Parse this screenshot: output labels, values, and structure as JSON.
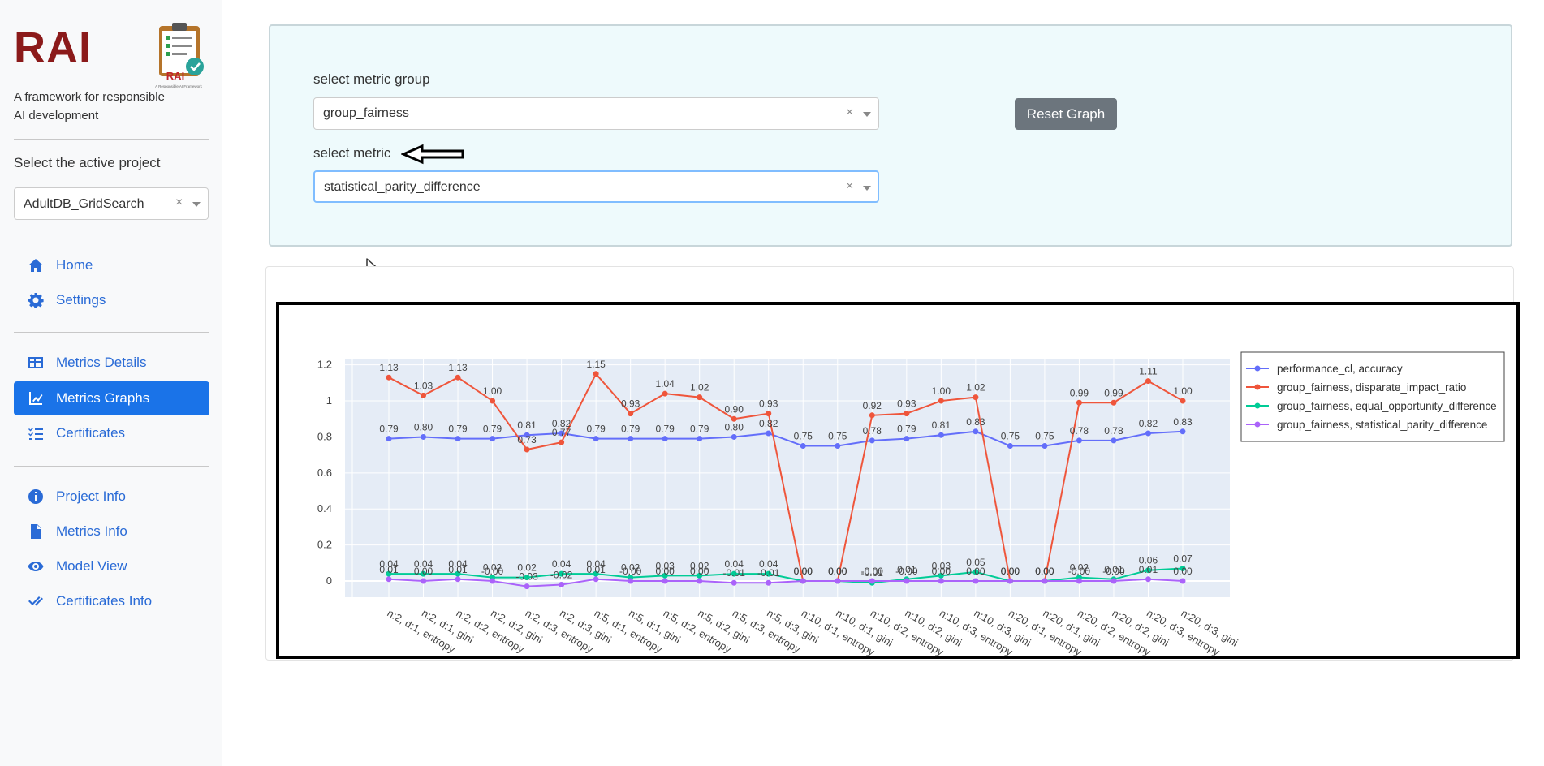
{
  "sidebar": {
    "brand": "RAI",
    "logo_text": "RAI",
    "logo_subtext": "A Responsible AI Framework",
    "tagline": "A framework for responsible AI development",
    "project_label": "Select the active project",
    "project_value": "AdultDB_GridSearch",
    "clear_glyph": "×",
    "nav_primary": [
      {
        "label": "Home",
        "icon": "home-icon"
      },
      {
        "label": "Settings",
        "icon": "gear-icon"
      }
    ],
    "nav_metrics": [
      {
        "label": "Metrics Details",
        "icon": "table-icon"
      },
      {
        "label": "Metrics Graphs",
        "icon": "chart-icon",
        "active": true
      },
      {
        "label": "Certificates",
        "icon": "checklist-icon"
      }
    ],
    "nav_info": [
      {
        "label": "Project Info",
        "icon": "info-icon"
      },
      {
        "label": "Metrics Info",
        "icon": "file-icon"
      },
      {
        "label": "Model View",
        "icon": "eye-icon"
      },
      {
        "label": "Certificates Info",
        "icon": "double-check-icon"
      }
    ]
  },
  "controls": {
    "group_label": "select metric group",
    "group_value": "group_fairness",
    "metric_label": "select metric",
    "metric_value": "statistical_parity_difference",
    "clear_glyph": "×",
    "reset_label": "Reset Graph"
  },
  "colors": {
    "accent": "#1a73e8",
    "brand": "#8b1a1a",
    "panel_bg": "#eefafc",
    "plot_bg": "#e5ecf6"
  },
  "chart_data": {
    "type": "line",
    "x": [
      "n:2, d:1, entropy",
      "n:2, d:1, gini",
      "n:2, d:2, entropy",
      "n:2, d:2, gini",
      "n:2, d:3, entropy",
      "n:2, d:3, gini",
      "n:5, d:1, entropy",
      "n:5, d:1, gini",
      "n:5, d:2, entropy",
      "n:5, d:2, gini",
      "n:5, d:3, entropy",
      "n:5, d:3, gini",
      "n:10, d:1, entropy",
      "n:10, d:1, gini",
      "n:10, d:2, entropy",
      "n:10, d:2, gini",
      "n:10, d:3, entropy",
      "n:10, d:3, gini",
      "n:20, d:1, entropy",
      "n:20, d:1, gini",
      "n:20, d:2, entropy",
      "n:20, d:2, gini",
      "n:20, d:3, entropy",
      "n:20, d:3, gini"
    ],
    "yticks": [
      "0",
      "0.2",
      "0.4",
      "0.6",
      "0.8",
      "1",
      "1.2"
    ],
    "ylim": [
      -0.09,
      1.23
    ],
    "legend_position": "top-right",
    "grid": true,
    "series": [
      {
        "name": "performance_cl, accuracy",
        "color": "#636efa",
        "values": [
          0.79,
          0.8,
          0.79,
          0.79,
          0.81,
          0.82,
          0.79,
          0.79,
          0.79,
          0.79,
          0.8,
          0.82,
          0.75,
          0.75,
          0.78,
          0.79,
          0.81,
          0.83,
          0.75,
          0.75,
          0.78,
          0.78,
          0.82,
          0.83
        ],
        "labels": [
          "0.79",
          "0.80",
          "0.79",
          "0.79",
          "0.81",
          "0.82",
          "0.79",
          "0.79",
          "0.79",
          "0.79",
          "0.80",
          "0.82",
          "0.75",
          "0.75",
          "0.78",
          "0.79",
          "0.81",
          "0.83",
          "0.75",
          "0.75",
          "0.78",
          "0.78",
          "0.82",
          "0.83"
        ]
      },
      {
        "name": "group_fairness, disparate_impact_ratio",
        "color": "#ef553b",
        "values": [
          1.13,
          1.03,
          1.13,
          1.0,
          0.73,
          0.77,
          1.15,
          0.93,
          1.04,
          1.02,
          0.9,
          0.93,
          0.0,
          0.0,
          0.92,
          0.93,
          1.0,
          1.02,
          0.0,
          0.0,
          0.99,
          0.99,
          1.11,
          1.0
        ],
        "labels": [
          "1.13",
          "1.03",
          "1.13",
          "1.00",
          "0.73",
          "0.77",
          "1.15",
          "0.93",
          "1.04",
          "1.02",
          "0.90",
          "0.93",
          "0.00",
          "0.00",
          "0.92",
          "0.93",
          "1.00",
          "1.02",
          "0.00",
          "0.00",
          "0.99",
          "0.99",
          "1.11",
          "1.00"
        ]
      },
      {
        "name": "group_fairness, equal_opportunity_difference",
        "color": "#00cc96",
        "values": [
          0.04,
          0.04,
          0.04,
          0.02,
          0.02,
          0.04,
          0.04,
          0.02,
          0.03,
          0.03,
          0.04,
          0.04,
          0.0,
          0.0,
          -0.01,
          0.01,
          0.03,
          0.05,
          0.0,
          0.0,
          0.02,
          0.01,
          0.06,
          0.07
        ],
        "labels": [
          "0.04",
          "0.04",
          "0.04",
          "0.02",
          "0.02",
          "0.04",
          "0.04",
          "0.02",
          "0.03",
          "0.02",
          "0.04",
          "0.04",
          "0.00",
          "0.00",
          "-0.01",
          "0.01",
          "0.03",
          "0.05",
          "0.00",
          "0.00",
          "0.02",
          "0.01",
          "0.06",
          "0.07"
        ]
      },
      {
        "name": "group_fairness, statistical_parity_difference",
        "color": "#ab63fa",
        "values": [
          0.01,
          0.0,
          0.01,
          0.0,
          -0.03,
          -0.02,
          0.01,
          0.0,
          0.0,
          0.0,
          -0.01,
          -0.01,
          0.0,
          0.0,
          0.0,
          0.0,
          0.0,
          0.0,
          0.0,
          0.0,
          0.0,
          0.0,
          0.01,
          0.0
        ],
        "labels": [
          "0.01",
          "0.00",
          "0.01",
          "-0.00",
          "-0.03",
          "-0.02",
          "0.01",
          "-0.00",
          "0.00",
          "0.00",
          "-0.01",
          "-0.01",
          "0.00",
          "0.00",
          "-0.00",
          "-0.00",
          "0.00",
          "0.00",
          "0.00",
          "0.00",
          "-0.00",
          "-0.00",
          "0.01",
          "0.00"
        ]
      }
    ]
  }
}
